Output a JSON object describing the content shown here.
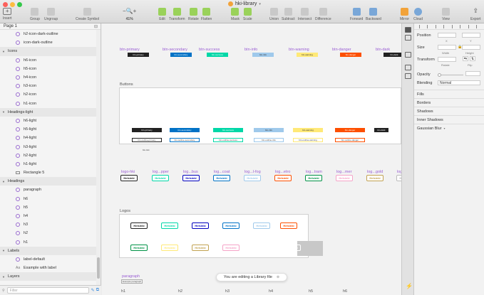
{
  "window": {
    "title": "hki-library",
    "colors": {
      "close": "#fc605b",
      "minimize": "#fdbc40",
      "zoom": "#34c84a",
      "accent": "#9a5fd4"
    }
  },
  "toolbar": {
    "insert": "Insert",
    "group": "Group",
    "ungroup": "Ungroup",
    "create_symbol": "Create Symbol",
    "zoom": "41%",
    "edit": "Edit",
    "transform": "Transform",
    "rotate": "Rotate",
    "flatten": "Flatten",
    "mask": "Mask",
    "scale": "Scale",
    "union": "Union",
    "subtract": "Subtract",
    "intersect": "Intersect",
    "difference": "Difference",
    "forward": "Forward",
    "backward": "Backward",
    "mirror": "Mirror",
    "cloud": "Cloud",
    "view": "View",
    "export": "Export"
  },
  "sidebar": {
    "page": "Page 1",
    "filter_placeholder": "Filter",
    "layers": [
      {
        "kind": "sym",
        "name": "h2-icon-dark-outline"
      },
      {
        "kind": "sym",
        "name": "icon-dark-outline"
      },
      {
        "kind": "grp",
        "name": "Icons"
      },
      {
        "kind": "sym",
        "name": "h6-icon"
      },
      {
        "kind": "sym",
        "name": "h5-icon"
      },
      {
        "kind": "sym",
        "name": "h4-icon"
      },
      {
        "kind": "sym",
        "name": "h3-icon"
      },
      {
        "kind": "sym",
        "name": "h2-icon"
      },
      {
        "kind": "sym",
        "name": "h1-icon"
      },
      {
        "kind": "grp",
        "name": "Headings-light"
      },
      {
        "kind": "sym",
        "name": "h6-light"
      },
      {
        "kind": "sym",
        "name": "h5-light"
      },
      {
        "kind": "sym",
        "name": "h4-light"
      },
      {
        "kind": "sym",
        "name": "h3-light"
      },
      {
        "kind": "sym",
        "name": "h2-light"
      },
      {
        "kind": "sym",
        "name": "h1-light"
      },
      {
        "kind": "rect",
        "name": "Rectangle 5"
      },
      {
        "kind": "grp",
        "name": "Headings"
      },
      {
        "kind": "sym",
        "name": "paragraph"
      },
      {
        "kind": "sym",
        "name": "h6"
      },
      {
        "kind": "sym",
        "name": "h5"
      },
      {
        "kind": "sym",
        "name": "h4"
      },
      {
        "kind": "sym",
        "name": "h3"
      },
      {
        "kind": "sym",
        "name": "h2"
      },
      {
        "kind": "sym",
        "name": "h1"
      },
      {
        "kind": "grp",
        "name": "Labels"
      },
      {
        "kind": "sym",
        "name": "label-default"
      },
      {
        "kind": "txt",
        "name": "Example with label"
      },
      {
        "kind": "grp",
        "name": "Layers"
      }
    ]
  },
  "canvas": {
    "button_symbols": [
      {
        "label": "btn-primary",
        "chip": "btn-primary",
        "color": "#222222"
      },
      {
        "label": "btn-secondary",
        "chip": "btn-secondary",
        "color": "#0072c6"
      },
      {
        "label": "btn-success",
        "chip": "btn-success",
        "color": "#00d7a7"
      },
      {
        "label": "btn-info",
        "chip": "btn-info",
        "color": "#9fc9eb"
      },
      {
        "label": "btn-warning",
        "chip": "btn-warning",
        "color": "#ffe977"
      },
      {
        "label": "btn-danger",
        "chip": "btn-danger",
        "color": "#fd4f00"
      },
      {
        "label": "btn-dark",
        "chip": "btn-dark",
        "color": "#222222"
      }
    ],
    "buttons_title": "Buttons",
    "buttons_row1": [
      {
        "text": "btn-primary",
        "color": "#222222"
      },
      {
        "text": "btn-secondary",
        "color": "#0072c6"
      },
      {
        "text": "btn-success",
        "color": "#00d7a7"
      },
      {
        "text": "btn-info",
        "color": "#9fc9eb"
      },
      {
        "text": "btn-warning",
        "color": "#ffe977"
      },
      {
        "text": "btn-danger",
        "color": "#fd4f00"
      },
      {
        "text": "btn-dark",
        "color": "#222222"
      }
    ],
    "buttons_row2": [
      {
        "text": "btn-outline-primary",
        "color": "#222222"
      },
      {
        "text": "btn-outline-secondary",
        "color": "#0072c6"
      },
      {
        "text": "btn-outline-success",
        "color": "#00d7a7"
      },
      {
        "text": "btn-outline-info",
        "color": "#9fc9eb"
      },
      {
        "text": "btn-outline-warning",
        "color": "#ffe977"
      },
      {
        "text": "btn-outline-danger",
        "color": "#fd4f00"
      }
    ],
    "btn_link": "btn-link",
    "logo_symbols": [
      {
        "label": "logo-hki",
        "color": "#222222"
      },
      {
        "label": "log...pper",
        "color": "#00d7a7"
      },
      {
        "label": "log...bus",
        "color": "#0000bf"
      },
      {
        "label": "log...coat",
        "color": "#0072c6"
      },
      {
        "label": "log...l-fog",
        "color": "#9fc9eb"
      },
      {
        "label": "log...etro",
        "color": "#fd4f00"
      },
      {
        "label": "log...tram",
        "color": "#009246"
      },
      {
        "label": "log...mer",
        "color": "#f5a3c7"
      },
      {
        "label": "log...gold",
        "color": "#c2a251"
      },
      {
        "label": "log...silver",
        "color": "#bbbbbb"
      }
    ],
    "logo_text": "Helsinki",
    "logos_title": "Logos",
    "logos_row1": [
      "#222222",
      "#00d7a7",
      "#0000bf",
      "#0072c6",
      "#9fc9eb",
      "#fd4f00"
    ],
    "logos_row2": [
      "#009246",
      "#ffe977",
      "#c2a251",
      "#f5a3c7",
      "#ffffff"
    ],
    "paragraph_label": "paragraph",
    "paragraph_sub": "Example paragraph",
    "headings": [
      "h1",
      "h2",
      "h3",
      "h4",
      "h5",
      "h6"
    ],
    "toast": "You are editing a Library file"
  },
  "inspector": {
    "position": "Position",
    "x": "X",
    "y": "Y",
    "size": "Size",
    "width": "Width",
    "height": "Height",
    "transform": "Transform",
    "rotate": "Rotate",
    "flip": "Flip",
    "opacity": "Opacity",
    "blending": "Blending",
    "blending_value": "Normal",
    "fills": "Fills",
    "borders": "Borders",
    "shadows": "Shadows",
    "inner_shadows": "Inner Shadows",
    "gaussian_blur": "Gaussian Blur"
  }
}
